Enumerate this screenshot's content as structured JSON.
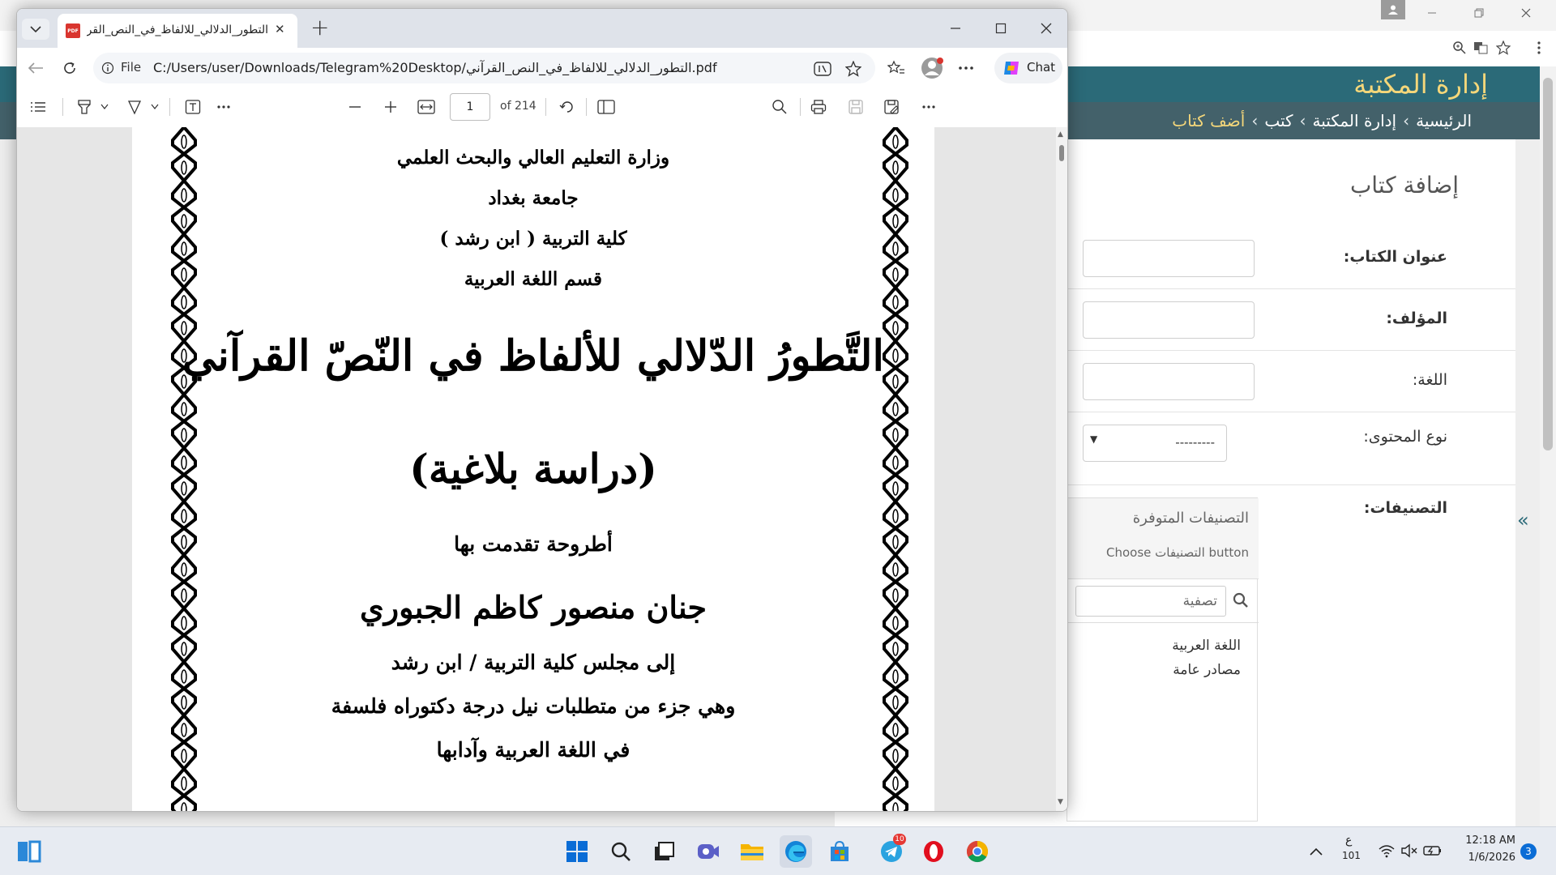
{
  "background_browser": {
    "admin": {
      "site_title": "إدارة المكتبة",
      "breadcrumb": [
        {
          "label": "الرئيسية"
        },
        {
          "label": "إدارة المكتبة"
        },
        {
          "label": "كتب"
        },
        {
          "label": "أضف كتاب"
        }
      ],
      "breadcrumb_sep": "›",
      "page_heading": "إضافة كتاب",
      "form": {
        "title_label": "عنوان الكتاب:",
        "author_label": "المؤلف:",
        "language_label": "اللغة:",
        "content_type_label": "نوع المحتوى:",
        "content_type_value": "---------",
        "categories_label": "التصنيفات:",
        "available_categories_title": "التصنيفات المتوفرة",
        "available_categories_help": "Choose التصنيفات button",
        "filter_placeholder": "تصفية",
        "categories": [
          "اللغة العربية",
          "مصادر عامة"
        ]
      }
    }
  },
  "pdf_window": {
    "tab_title": "التطور_الدلالي_للالفاظ_في_النص_القرآني",
    "tab_close": "✕",
    "new_tab": "+",
    "address_prefix": "File",
    "address": "C:/Users/user/Downloads/Telegram%20Desktop/التطور_الدلالي_للالفاظ_في_النص_القرآني.pdf",
    "chat_label": "Chat",
    "page_current": "1",
    "page_total": "of 214"
  },
  "document": {
    "ministry": "وزارة التعليم العالي والبحث العلمي",
    "university": "جامعة بغداد",
    "college": "كلية التربية ( ابن رشد )",
    "department": "قسم اللغة العربية",
    "title": "التَّطورُ الدّلالي للألفاظ في النّصّ القرآني",
    "subtitle": "(دراسة بلاغية)",
    "submitted_by": "أطروحة تقدمت بها",
    "author": "جنان منصور كاظم الجبوري",
    "to_council": "إلى مجلس كلية التربية / ابن رشد",
    "requirement": "وهي جزء من متطلبات نيل درجة دكتوراه فلسفة",
    "field": "في اللغة العربية وآدابها"
  },
  "taskbar": {
    "lang": "ع",
    "lang_sub": "101",
    "time": "12:18 AM",
    "date": "1/6/2026",
    "notification_count": "3",
    "telegram_badge": "10"
  },
  "colors": {
    "admin_header": "#2b6a78",
    "admin_breadcrumb_bar": "#43616a",
    "admin_accent": "#f5d77a",
    "taskbar": "#e7ebf2"
  }
}
